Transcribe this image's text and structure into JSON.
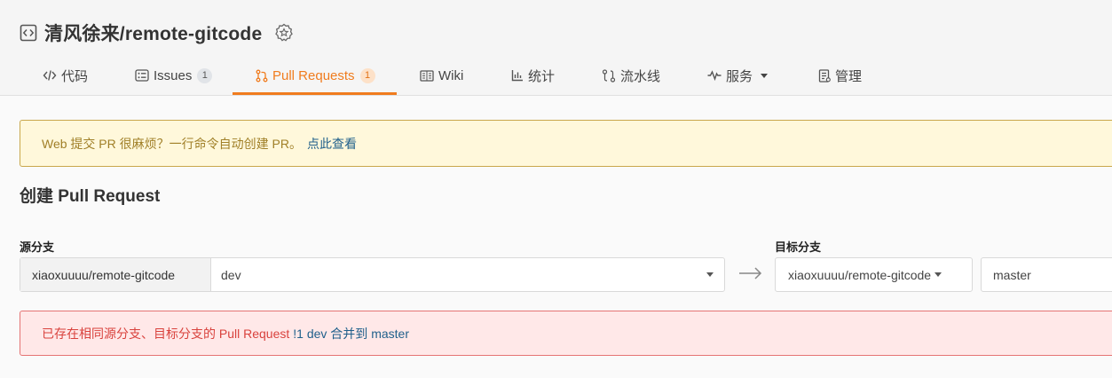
{
  "repo": {
    "title": "清风徐来/remote-gitcode"
  },
  "tabs": [
    {
      "label": "代码",
      "icon": "code-icon"
    },
    {
      "label": "Issues",
      "count": "1",
      "icon": "issues-icon"
    },
    {
      "label": "Pull Requests",
      "count": "1",
      "icon": "pull-request-icon",
      "active": true
    },
    {
      "label": "Wiki",
      "icon": "wiki-icon"
    },
    {
      "label": "统计",
      "icon": "stats-icon"
    },
    {
      "label": "流水线",
      "icon": "pipeline-icon"
    },
    {
      "label": "服务",
      "icon": "service-icon"
    },
    {
      "label": "管理",
      "icon": "manage-icon"
    }
  ],
  "notice": {
    "text": "Web 提交 PR 很麻烦？一行命令自动创建 PR。",
    "link": "点此查看"
  },
  "form": {
    "title": "创建 Pull Request",
    "source_label": "源分支",
    "target_label": "目标分支",
    "source_repo": "xiaoxuuuu/remote-gitcode",
    "source_branch": "dev",
    "target_repo": "xiaoxuuuu/remote-gitcode",
    "target_branch": "master"
  },
  "error": {
    "text": "已存在相同源分支、目标分支的 Pull Request",
    "link": "!1 dev 合并到 master"
  },
  "colors": {
    "accent": "#f07c1e",
    "notice_bg": "#fff8db",
    "error_bg": "#ffe8e8",
    "link": "#1f5f8b"
  }
}
